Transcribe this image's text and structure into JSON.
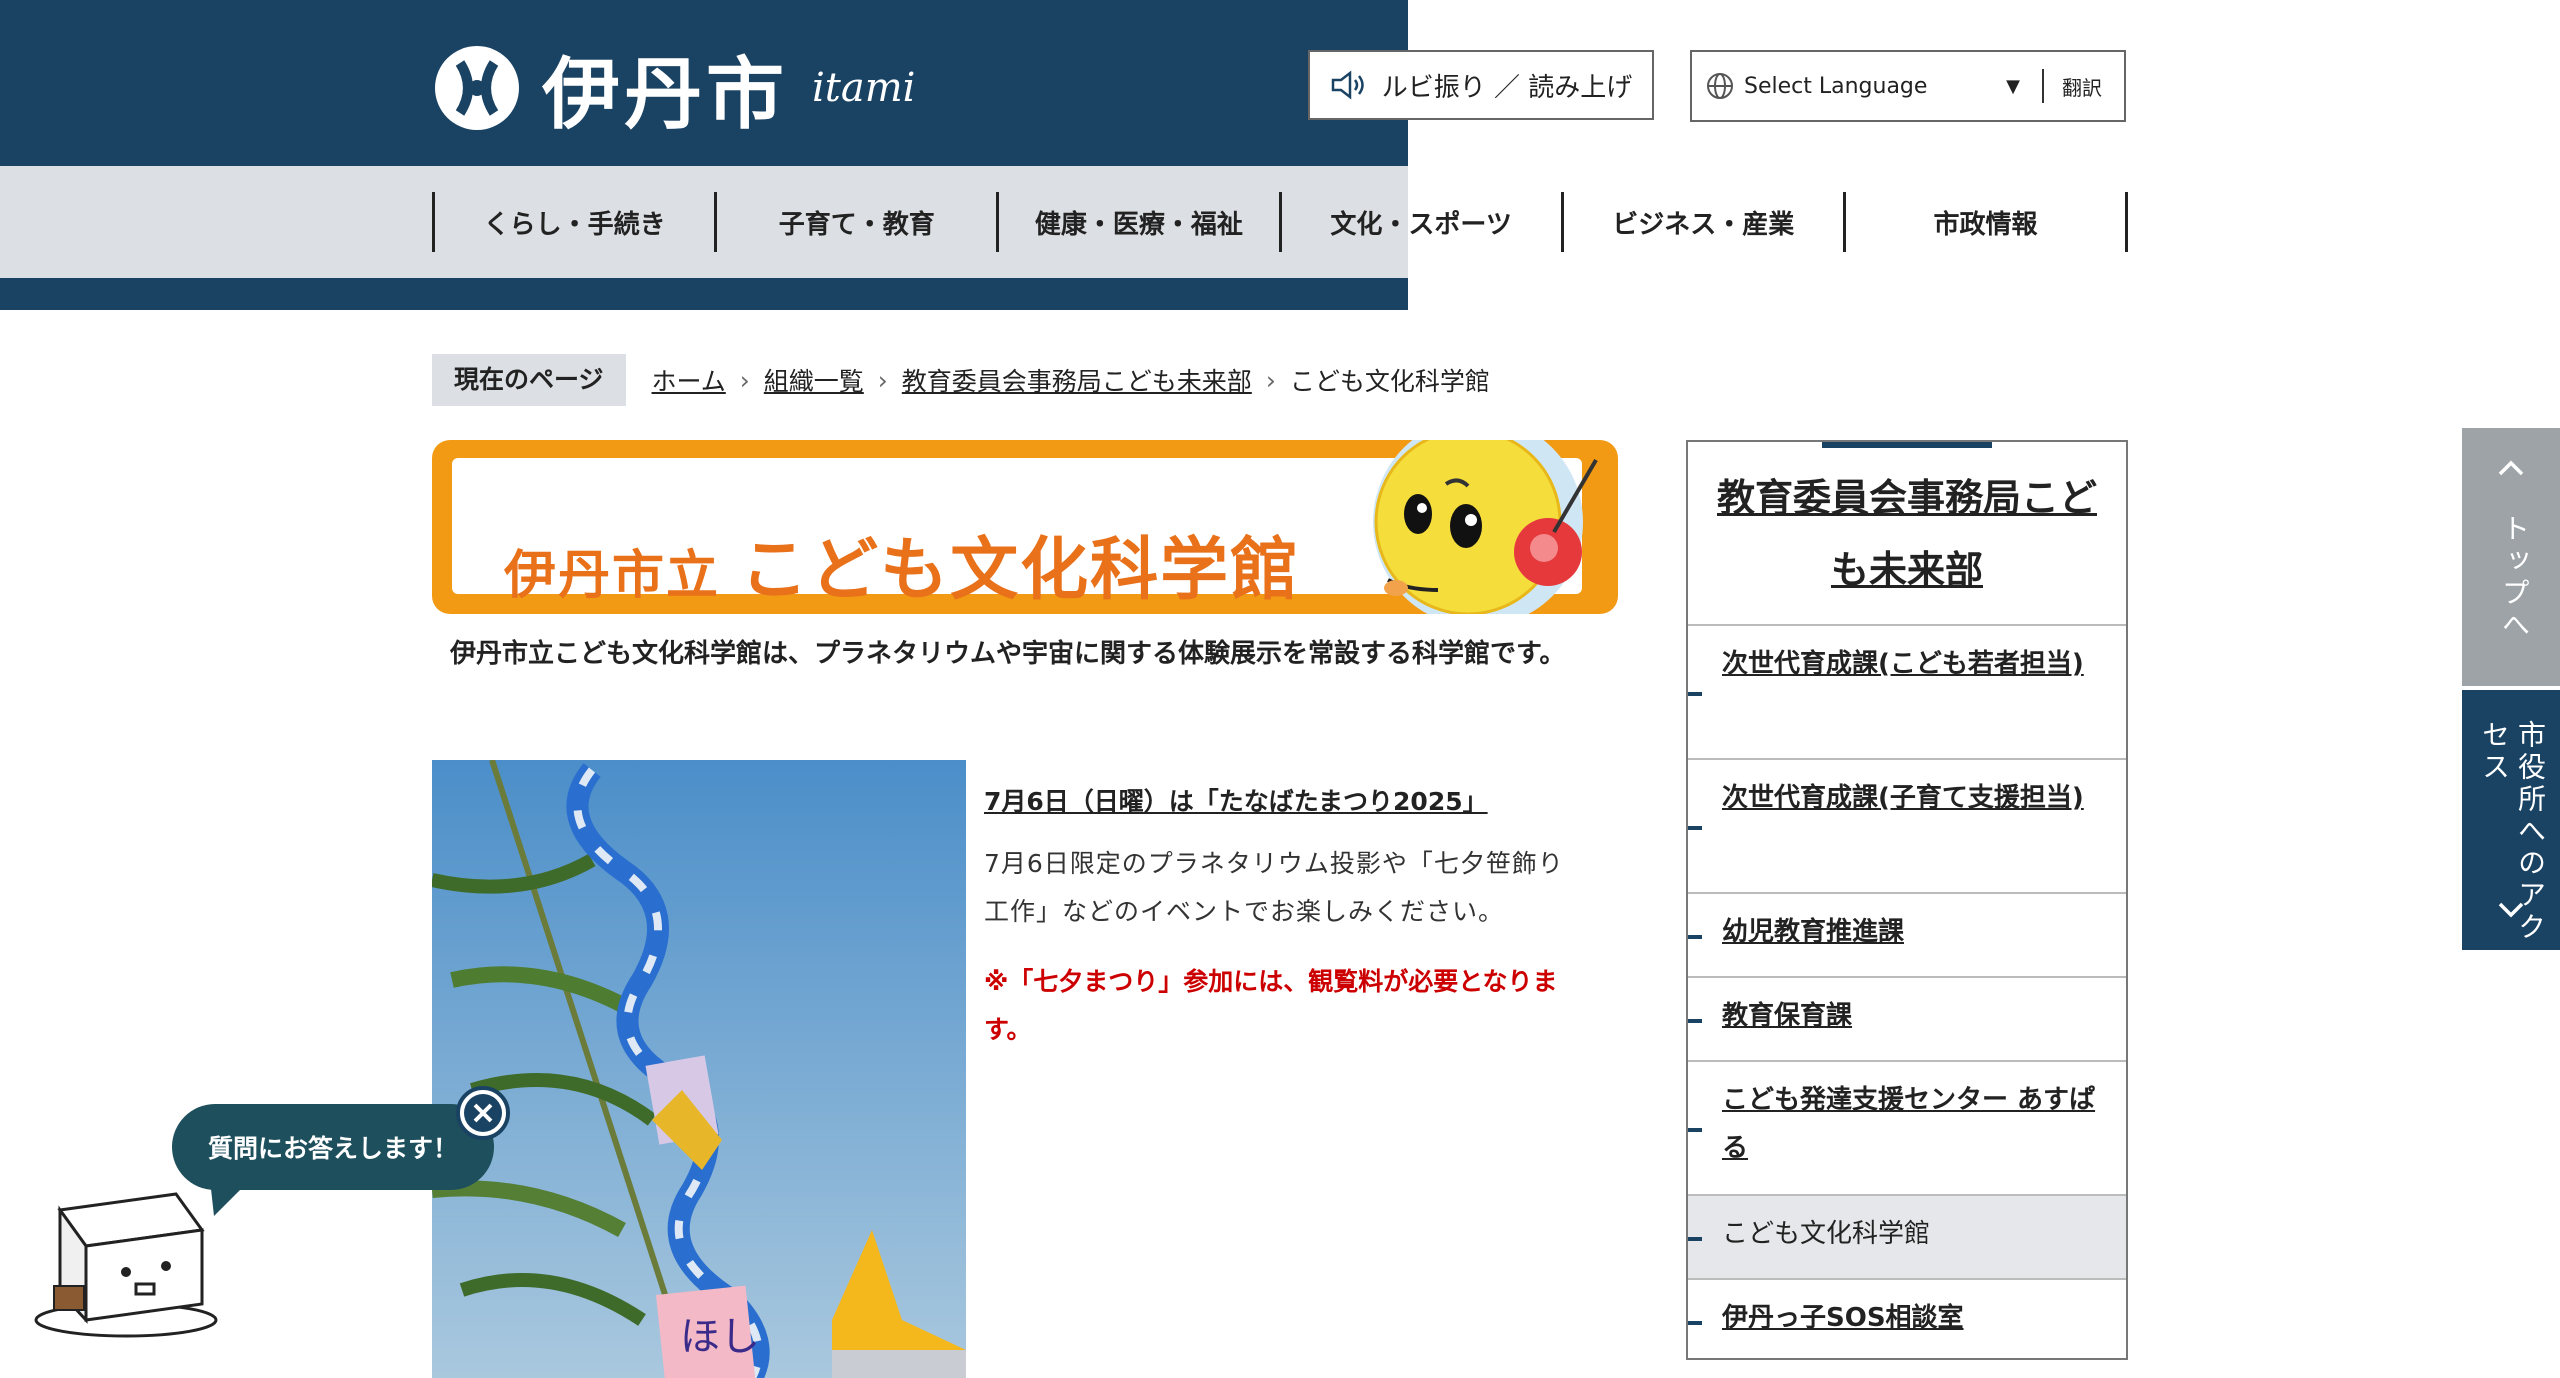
{
  "header": {
    "logo_text": "伊丹市",
    "logo_roman": "itami",
    "ruby_button": "ルビ振り ／ 読み上げ",
    "language_select": "Select Language",
    "translate_label": "翻訳"
  },
  "nav": {
    "items": [
      "くらし・手続き",
      "子育て・教育",
      "健康・医療・福祉",
      "文化・スポーツ",
      "ビジネス・産業",
      "市政情報"
    ]
  },
  "breadcrumb": {
    "label": "現在のページ",
    "links": [
      "ホーム",
      "組織一覧",
      "教育委員会事務局こども未来部"
    ],
    "current": "こども文化科学館"
  },
  "banner": {
    "title_prefix": "伊丹市立",
    "title_main": "こども文化科学館"
  },
  "intro": "伊丹市立こども文化科学館は、プラネタリウムや宇宙に関する体験展示を常設する科学館です。",
  "event": {
    "title": "7月6日（日曜）は「たなばたまつり2025」",
    "body": "7月6日限定のプラネタリウム投影や「七夕笹飾り工作」などのイベントでお楽しみください。",
    "note": "※「七夕まつり」参加には、観覧料が必要となります。"
  },
  "sidebar": {
    "title": "教育委員会事務局こども未来部",
    "items": [
      "次世代育成課(こども若者担当)",
      "次世代育成課(子育て支援担当)",
      "幼児教育推進課",
      "教育保育課",
      "こども発達支援センター あすぱる",
      "こども文化科学館",
      "伊丹っ子SOS相談室"
    ]
  },
  "floating": {
    "top_tab": "トップへ",
    "access_tab": "市役所へのアクセス"
  },
  "chatbot": {
    "bubble": "質問にお答えします！"
  },
  "colors": {
    "header_navy": "#1a4263",
    "nav_gray": "#dcdfe3",
    "banner_orange": "#f29a14",
    "note_red": "#cc0000"
  }
}
